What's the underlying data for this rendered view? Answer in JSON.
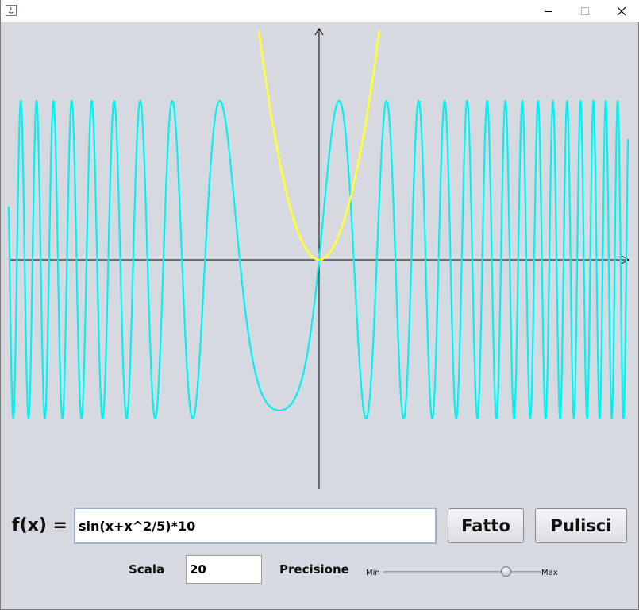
{
  "window": {
    "icons": {
      "app": "java-app-icon",
      "minimize": "minimize-icon",
      "maximize": "maximize-icon",
      "close": "close-icon"
    }
  },
  "graph": {
    "colors": {
      "sine": "#00f2f2",
      "parabola": "#ffff33",
      "axes": "#000000"
    },
    "curves": [
      {
        "color": "cyan",
        "expression": "sin(x+x^2/5)*10"
      },
      {
        "color": "yellow",
        "expression": "x^2"
      }
    ]
  },
  "form": {
    "fx_label": "f(x) =",
    "fx_value": "sin(x+x^2/5)*10",
    "fatto_label": "Fatto",
    "pulisci_label": "Pulisci",
    "scala_label": "Scala",
    "scala_value": "20",
    "precisione_label": "Precisione",
    "slider_min_label": "Min",
    "slider_max_label": "Max",
    "slider_level": 0.78
  }
}
